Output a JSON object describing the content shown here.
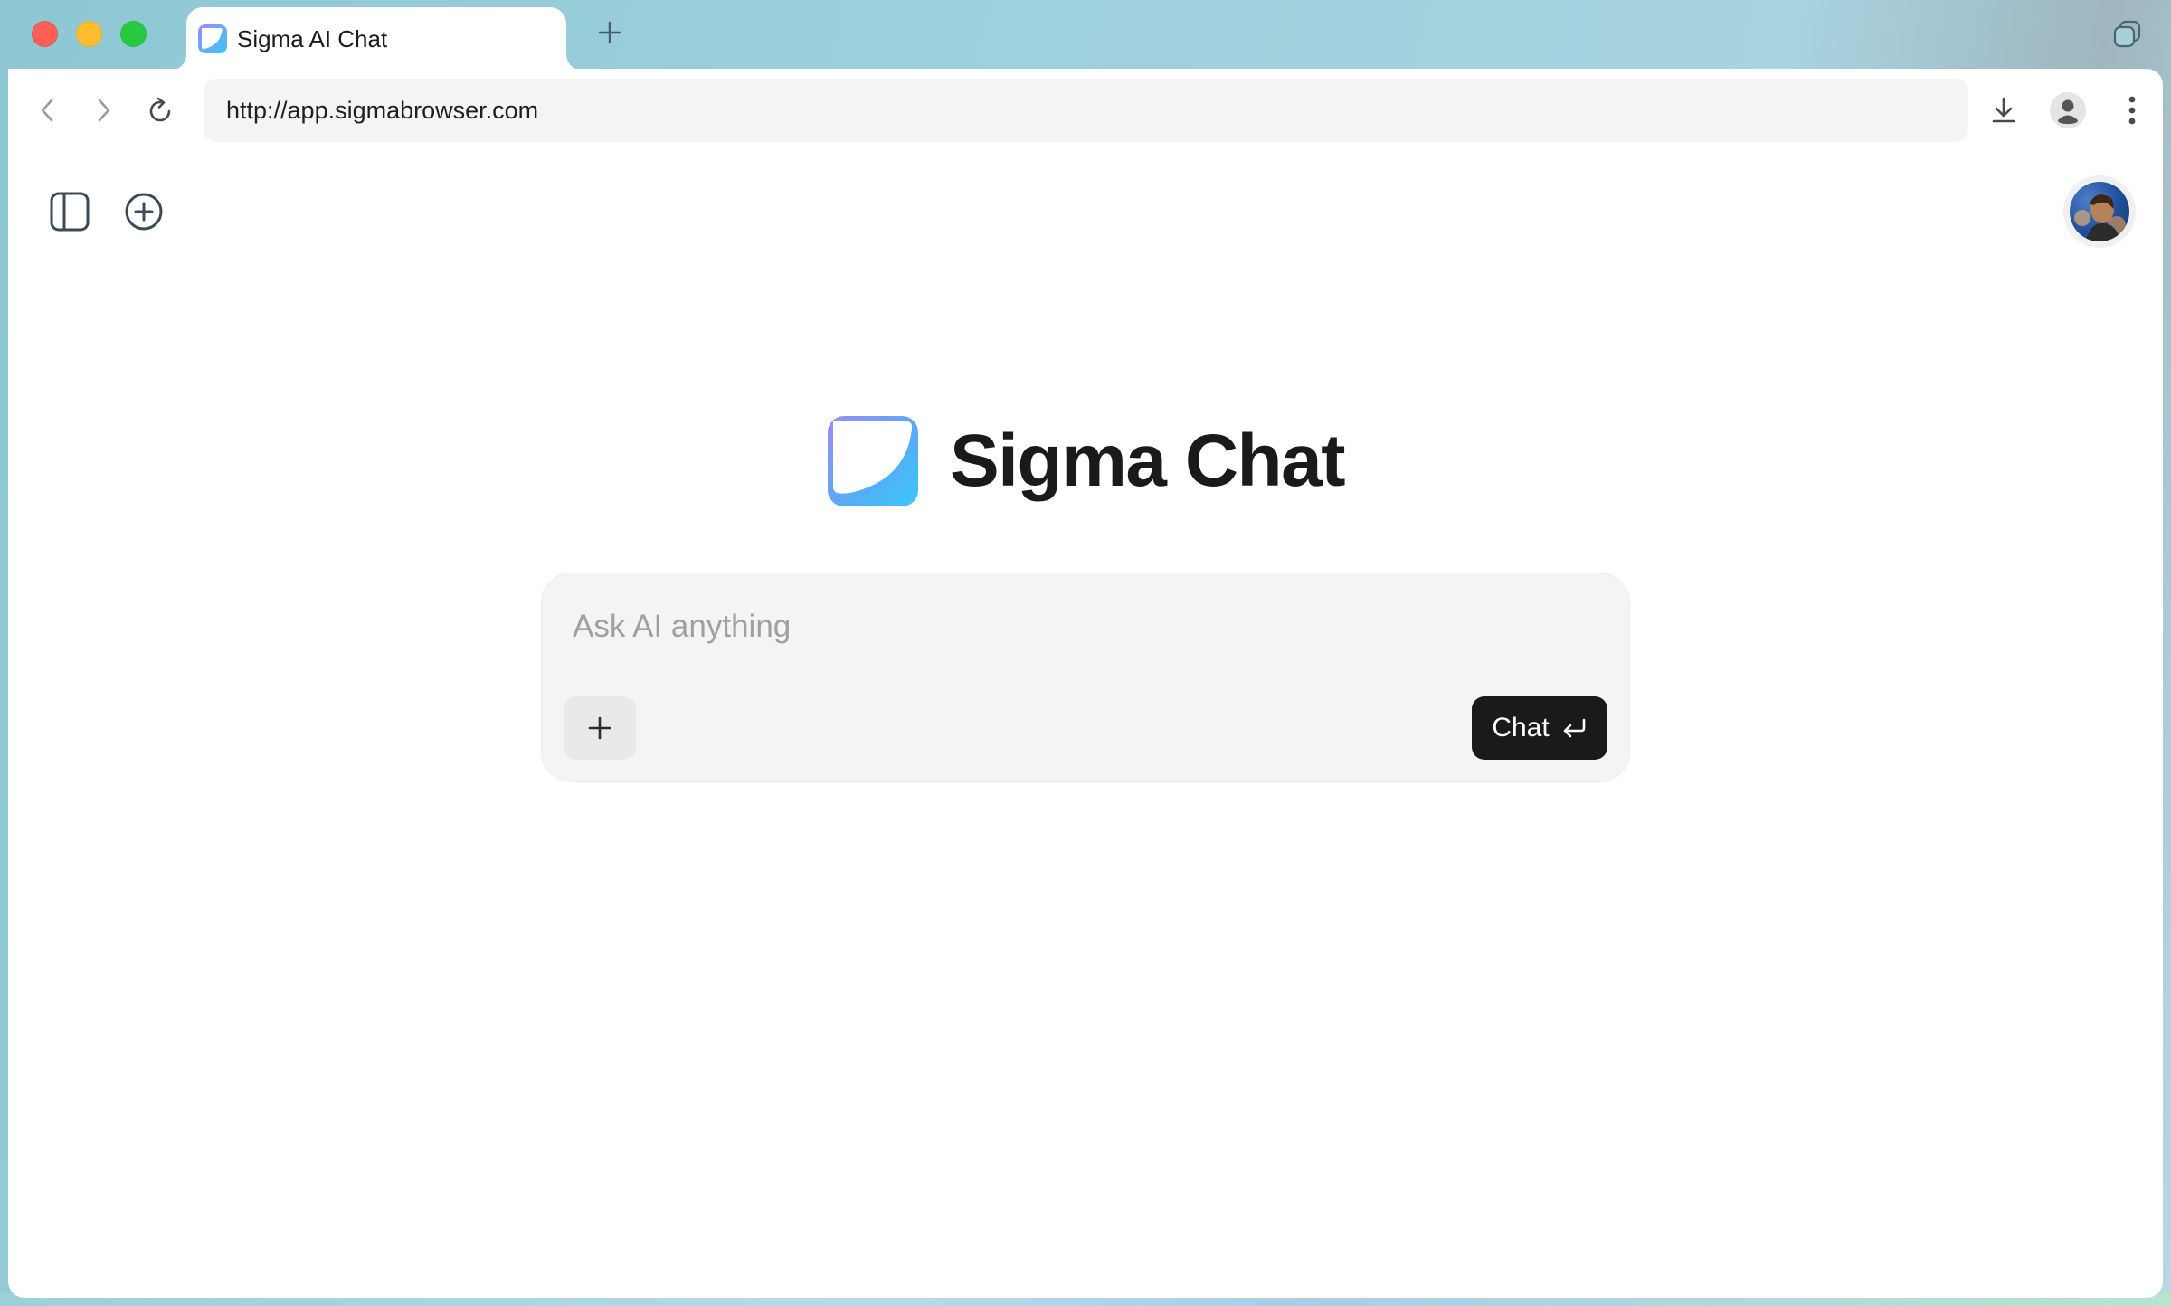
{
  "colors": {
    "close": "#fe5f57",
    "minimize": "#febc2e",
    "maximize": "#28c840",
    "chat_button_bg": "#1a1a1a",
    "composer_bg": "#f4f4f4",
    "logo_gradient_start": "#9b8cf5",
    "logo_gradient_end": "#38c8f6"
  },
  "window_controls": {
    "close": "close-window",
    "minimize": "minimize-window",
    "maximize": "maximize-window"
  },
  "tab": {
    "title": "Sigma AI Chat",
    "favicon": "sigma-logo-icon"
  },
  "toolbar": {
    "url": "http://app.sigmabrowser.com",
    "icons": [
      "back-icon",
      "forward-icon",
      "reload-icon",
      "download-icon",
      "profile-icon",
      "more-vert-icon"
    ]
  },
  "app": {
    "top_icons": [
      "sidebar-toggle-icon",
      "new-chat-icon"
    ],
    "avatar": "user-avatar"
  },
  "hero": {
    "title": "Sigma Chat"
  },
  "composer": {
    "placeholder": "Ask AI anything",
    "value": "",
    "attach_icon": "plus-icon",
    "submit_label": "Chat",
    "submit_icon": "enter-icon"
  }
}
